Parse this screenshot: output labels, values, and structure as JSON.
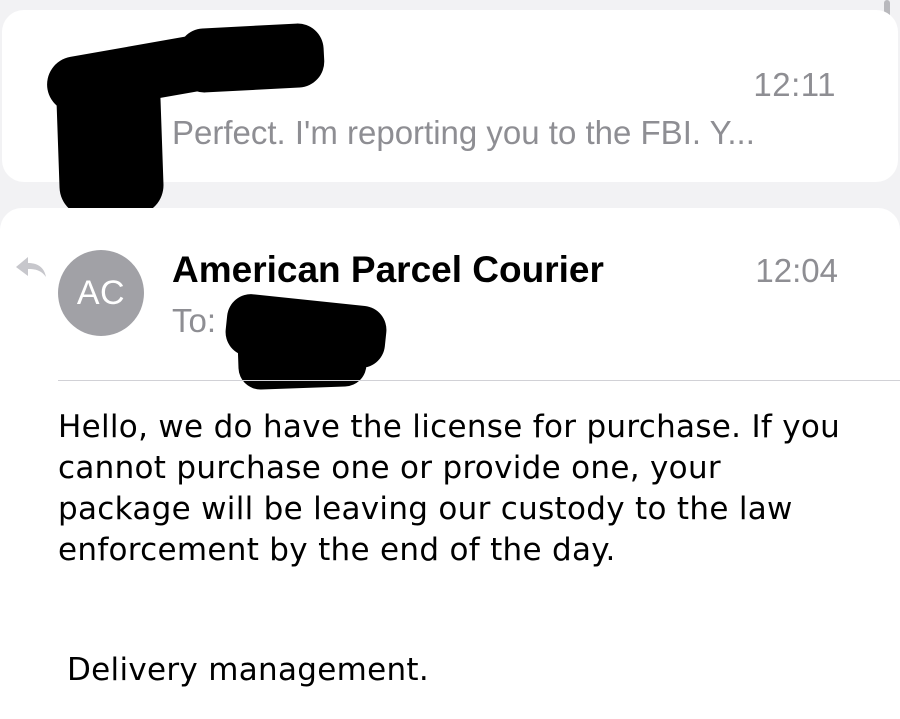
{
  "collapsed_message": {
    "time": "12:11",
    "preview": "Perfect. I'm reporting you to the FBI. Y..."
  },
  "expanded_message": {
    "avatar_initials": "AC",
    "sender": "American Parcel Courier",
    "time": "12:04",
    "to_label": "To:",
    "body": "Hello, we do have the license for purchase. If you cannot purchase one or provide one, your package will be leaving our custody to the law enforcement by the end of the day.",
    "signature": "Delivery management."
  },
  "icons": {
    "reply": "reply-arrow-icon"
  },
  "colors": {
    "background": "#f2f2f4",
    "card": "#ffffff",
    "secondary_text": "#8e8e93",
    "avatar": "#a1a1a6",
    "redaction": "#000000"
  }
}
